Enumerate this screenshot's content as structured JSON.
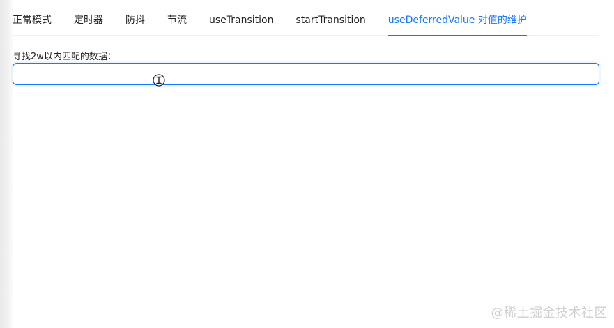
{
  "tabs": {
    "items": [
      {
        "label": "正常模式"
      },
      {
        "label": "定时器"
      },
      {
        "label": "防抖"
      },
      {
        "label": "节流"
      },
      {
        "label": "useTransition"
      },
      {
        "label": "startTransition"
      },
      {
        "label": "useDeferredValue 对值的维护"
      }
    ],
    "active_index": 6,
    "active_color": "#1677ff"
  },
  "search": {
    "label": "寻找2w以内匹配的数据：",
    "value": "",
    "placeholder": ""
  },
  "cursor": {
    "icon": "text-cursor-icon"
  },
  "watermark": {
    "text": "@稀土掘金技术社区"
  }
}
